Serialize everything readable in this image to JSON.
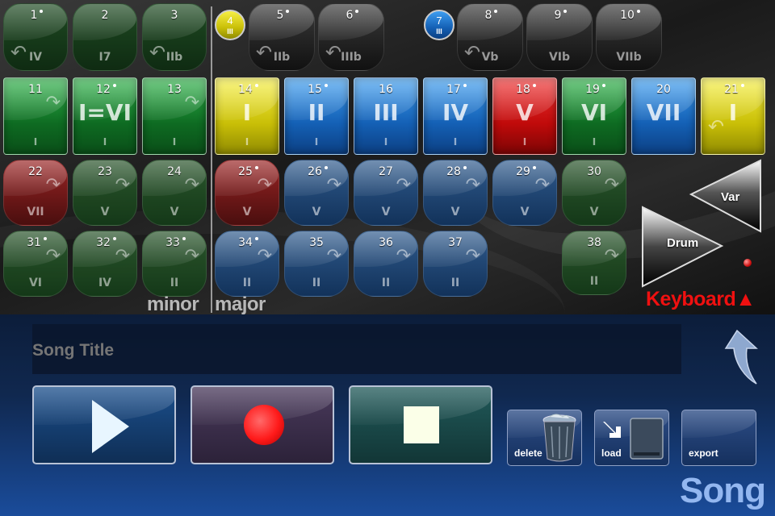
{
  "keyboard": {
    "minor_label": "minor",
    "major_label": "major",
    "mode_label": "Keyboard▲",
    "var_label": "Var",
    "drum_label": "Drum",
    "row0_left": [
      {
        "num": "1",
        "dot": true,
        "roman": "IV",
        "icon": "curve-left-arrow-icon"
      },
      {
        "num": "2",
        "dot": false,
        "roman": "I7",
        "icon": ""
      },
      {
        "num": "3",
        "dot": false,
        "roman": "IIb",
        "icon": "curve-left-arrow-icon"
      }
    ],
    "row0_circle_left": {
      "num": "4",
      "dot": true,
      "roman": "III"
    },
    "row0_black_left": [
      {
        "num": "5",
        "dot": true,
        "roman": "IIb",
        "icon": "curve-left-arrow-icon"
      },
      {
        "num": "6",
        "dot": true,
        "roman": "IIIb",
        "icon": "curve-left-arrow-icon"
      }
    ],
    "row0_circle_right": {
      "num": "7",
      "dot": true,
      "roman": "III"
    },
    "row0_black_right": [
      {
        "num": "8",
        "dot": true,
        "roman": "Vb",
        "icon": "curve-left-arrow-icon"
      },
      {
        "num": "9",
        "dot": true,
        "roman": "VIb",
        "icon": ""
      },
      {
        "num": "10",
        "dot": true,
        "roman": "VIIb",
        "icon": ""
      }
    ],
    "row1": [
      {
        "num": "11",
        "dot": false,
        "big": "",
        "roman": "I",
        "color": "green",
        "icon": "curve-right-arrow-icon"
      },
      {
        "num": "12",
        "dot": true,
        "big": "I=VI",
        "roman": "I",
        "color": "green",
        "icon": ""
      },
      {
        "num": "13",
        "dot": false,
        "big": "",
        "roman": "I",
        "color": "green",
        "icon": "curve-right-arrow-icon"
      },
      {
        "num": "14",
        "dot": true,
        "big": "I",
        "roman": "I",
        "color": "yellow",
        "icon": ""
      },
      {
        "num": "15",
        "dot": true,
        "big": "II",
        "roman": "I",
        "color": "blue",
        "icon": ""
      },
      {
        "num": "16",
        "dot": false,
        "big": "III",
        "roman": "I",
        "color": "blue",
        "icon": ""
      },
      {
        "num": "17",
        "dot": true,
        "big": "IV",
        "roman": "I",
        "color": "blue",
        "icon": ""
      },
      {
        "num": "18",
        "dot": true,
        "big": "V",
        "roman": "I",
        "color": "red",
        "icon": ""
      },
      {
        "num": "19",
        "dot": true,
        "big": "VI",
        "roman": "I",
        "color": "green",
        "icon": ""
      },
      {
        "num": "20",
        "dot": false,
        "big": "VII",
        "roman": "",
        "color": "blue",
        "icon": ""
      },
      {
        "num": "21",
        "dot": true,
        "big": "I",
        "roman": "",
        "color": "yellow",
        "icon": "curve-left-arrow-icon"
      }
    ],
    "row2": [
      {
        "num": "22",
        "dot": false,
        "roman": "VII",
        "color": "red"
      },
      {
        "num": "23",
        "dot": false,
        "roman": "V",
        "color": "green"
      },
      {
        "num": "24",
        "dot": false,
        "roman": "V",
        "color": "green"
      },
      {
        "num": "25",
        "dot": true,
        "roman": "V",
        "color": "red"
      },
      {
        "num": "26",
        "dot": true,
        "roman": "V",
        "color": "blue"
      },
      {
        "num": "27",
        "dot": false,
        "roman": "V",
        "color": "blue"
      },
      {
        "num": "28",
        "dot": true,
        "roman": "V",
        "color": "blue"
      },
      {
        "num": "29",
        "dot": true,
        "roman": "V",
        "color": "blue"
      },
      {
        "num": "30",
        "dot": false,
        "roman": "V",
        "color": "green"
      }
    ],
    "row3": [
      {
        "num": "31",
        "dot": true,
        "roman": "VI",
        "color": "green"
      },
      {
        "num": "32",
        "dot": true,
        "roman": "IV",
        "color": "green"
      },
      {
        "num": "33",
        "dot": true,
        "roman": "II",
        "color": "green"
      },
      {
        "num": "34",
        "dot": true,
        "roman": "II",
        "color": "blue"
      },
      {
        "num": "35",
        "dot": false,
        "roman": "II",
        "color": "blue"
      },
      {
        "num": "36",
        "dot": false,
        "roman": "II",
        "color": "blue"
      },
      {
        "num": "37",
        "dot": false,
        "roman": "II",
        "color": "blue"
      },
      {
        "num": "38",
        "dot": false,
        "roman": "II",
        "color": "green"
      }
    ]
  },
  "song": {
    "title_placeholder": "Song Title",
    "section_label": "Song",
    "delete_label": "delete",
    "load_label": "load",
    "export_label": "export"
  },
  "colors": {
    "play_bg": "#1b4f8c",
    "record_bg": "#4a3a5c",
    "stop_bg": "#215a5a",
    "record_dot": "#ff1a1a"
  }
}
